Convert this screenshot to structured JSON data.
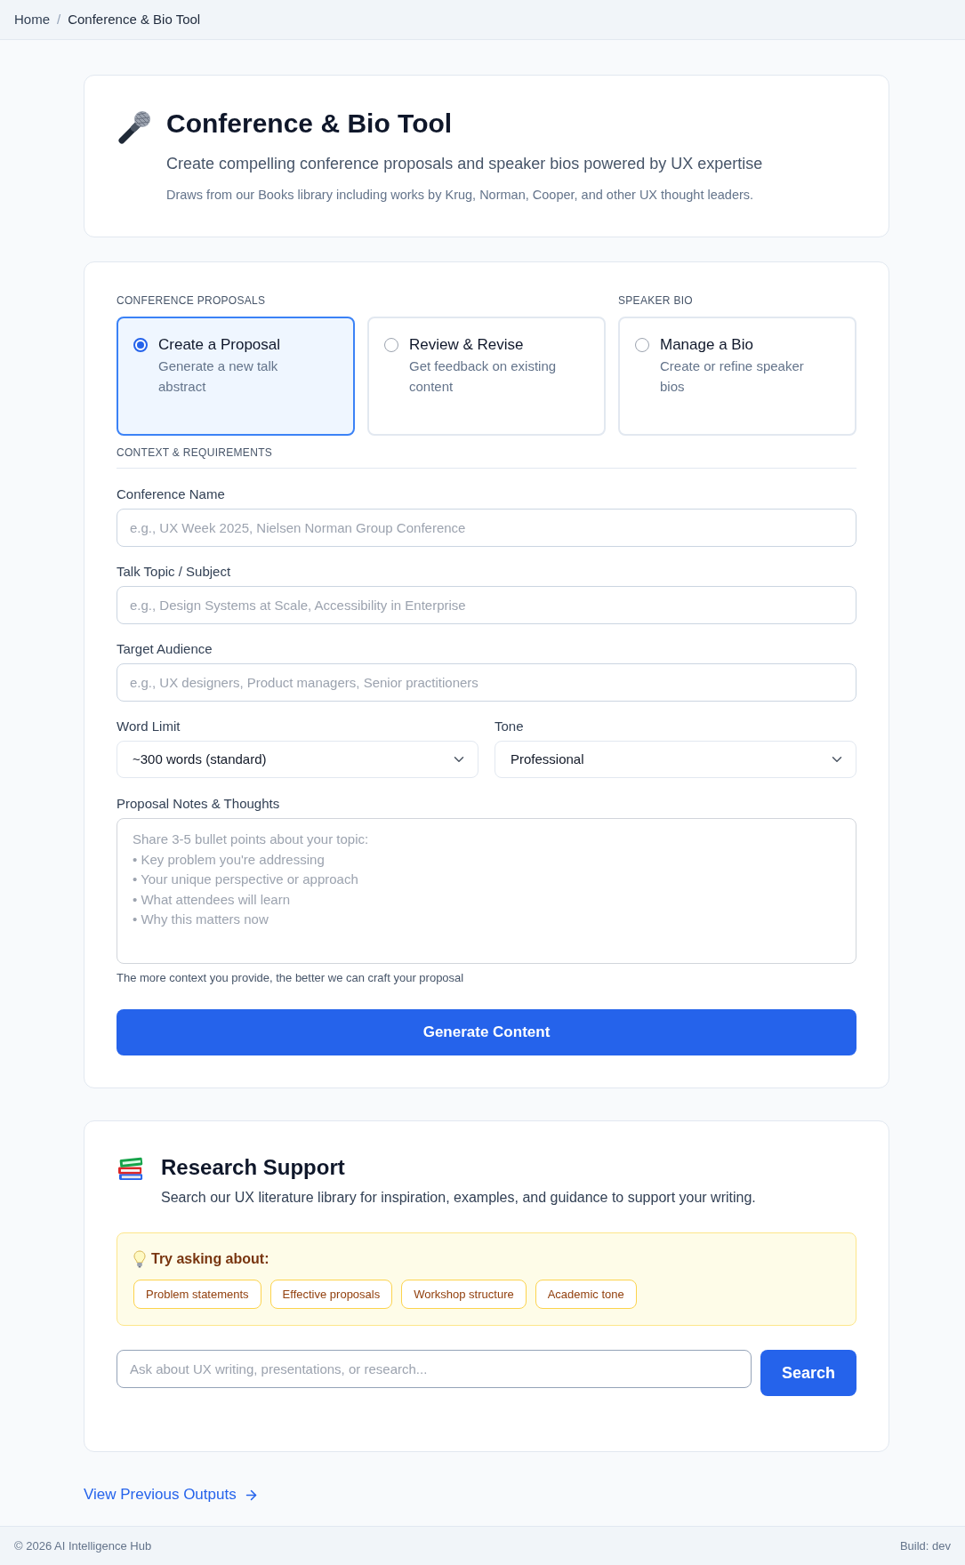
{
  "breadcrumb": {
    "items": [
      {
        "label": "Home",
        "kind": "link"
      },
      {
        "label": "Conference & Bio Tool",
        "kind": "current"
      }
    ],
    "separator": "/"
  },
  "header": {
    "title": "Conference & Bio Tool",
    "subtitle": "Create compelling conference proposals and speaker bios powered by UX expertise",
    "description": "Draws from our Books library including works by Krug, Norman, Cooper, and other UX thought leaders."
  },
  "mode_groups": [
    {
      "label": "CONFERENCE PROPOSALS",
      "options": [
        {
          "title": "Create a Proposal",
          "description": "Generate a new talk abstract",
          "selected": true
        },
        {
          "title": "Review & Revise",
          "description": "Get feedback on existing content",
          "selected": false
        }
      ]
    },
    {
      "label": "SPEAKER BIO",
      "options": [
        {
          "title": "Manage a Bio",
          "description": "Create or refine speaker bios",
          "selected": false
        }
      ]
    }
  ],
  "context": {
    "heading": "CONTEXT & REQUIREMENTS",
    "text_fields": [
      {
        "label": "Conference Name",
        "placeholder": "e.g., UX Week 2025, Nielsen Norman Group Conference"
      },
      {
        "label": "Talk Topic / Subject",
        "placeholder": "e.g., Design Systems at Scale, Accessibility in Enterprise"
      },
      {
        "label": "Target Audience",
        "placeholder": "e.g., UX designers, Product managers, Senior practitioners"
      }
    ],
    "select_fields": [
      {
        "label": "Word Limit",
        "value": "~300 words (standard)"
      },
      {
        "label": "Tone",
        "value": "Professional"
      }
    ],
    "notes": {
      "label": "Proposal Notes & Thoughts",
      "placeholder": "Share 3-5 bullet points about your topic:\n• Key problem you're addressing\n• Your unique perspective or approach\n• What attendees will learn\n• Why this matters now",
      "hint": "The more context you provide, the better we can craft your proposal"
    }
  },
  "generate_button": "Generate Content",
  "research": {
    "title": "Research Support",
    "description": "Search our UX literature library for inspiration, examples, and guidance to support your writing.",
    "suggestions": {
      "heading": "Try asking about:",
      "chips": [
        "Problem statements",
        "Effective proposals",
        "Workshop structure",
        "Academic tone"
      ]
    },
    "search": {
      "placeholder": "Ask about UX writing, presentations, or research...",
      "button": "Search"
    }
  },
  "view_outputs_link": "View Previous Outputs",
  "footer": {
    "copyright": "© 2026 AI Intelligence Hub",
    "build": "Build: dev"
  }
}
